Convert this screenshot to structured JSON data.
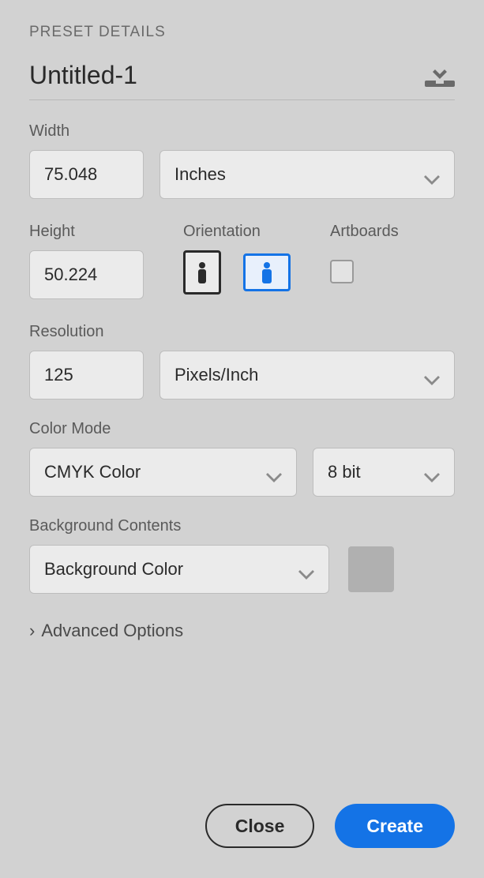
{
  "header": {
    "section_label": "PRESET DETAILS",
    "title": "Untitled-1"
  },
  "width": {
    "label": "Width",
    "value": "75.048",
    "unit": "Inches"
  },
  "height": {
    "label": "Height",
    "value": "50.224"
  },
  "orientation": {
    "label": "Orientation",
    "selected": "landscape"
  },
  "artboards": {
    "label": "Artboards",
    "checked": false
  },
  "resolution": {
    "label": "Resolution",
    "value": "125",
    "unit": "Pixels/Inch"
  },
  "color_mode": {
    "label": "Color Mode",
    "value": "CMYK Color",
    "depth": "8 bit"
  },
  "background": {
    "label": "Background Contents",
    "value": "Background Color",
    "swatch_color": "#b0b0b0"
  },
  "advanced_label": "Advanced Options",
  "footer": {
    "close": "Close",
    "create": "Create"
  }
}
